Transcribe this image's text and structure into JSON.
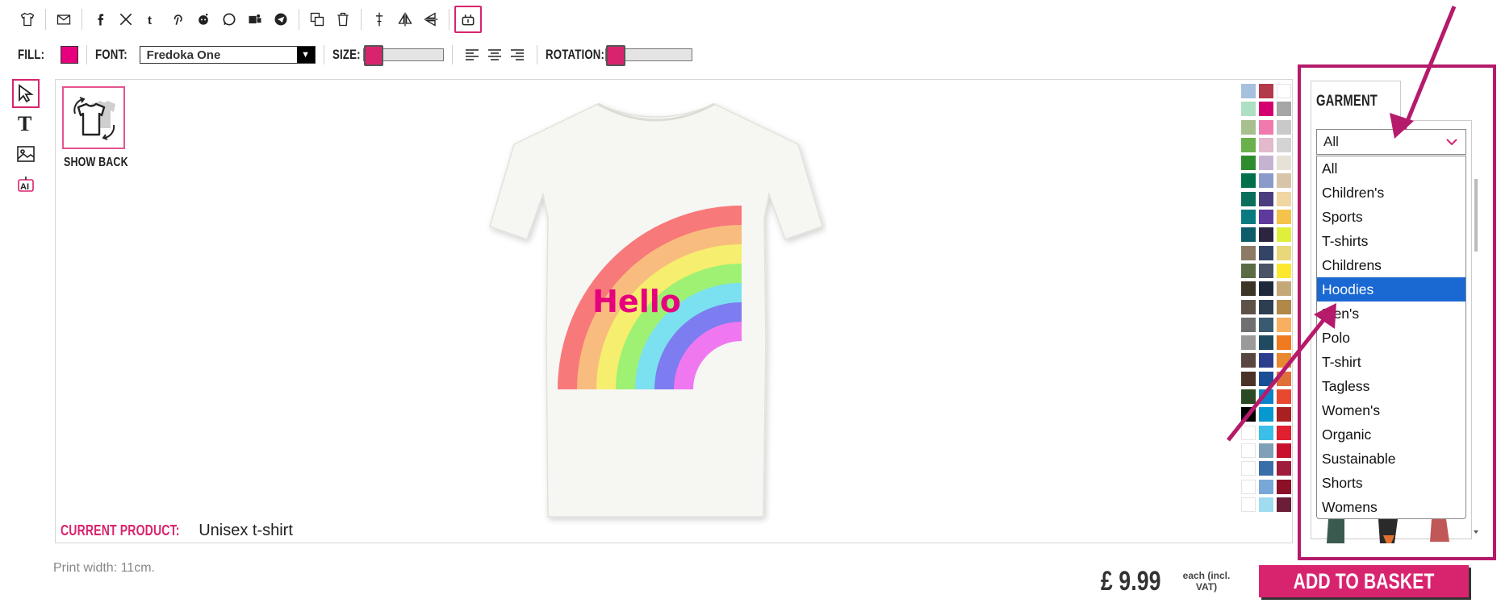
{
  "toolbar": {
    "icons": [
      "tshirt-icon",
      "email-icon",
      "facebook-icon",
      "x-icon",
      "tumblr-icon",
      "pinterest-icon",
      "reddit-icon",
      "whatsapp-icon",
      "teams-icon",
      "telegram-icon",
      "duplicate-icon",
      "delete-icon",
      "center-icon",
      "flip-horizontal-icon",
      "flip-vertical-icon",
      "snap-icon"
    ]
  },
  "props": {
    "fill_label": "FILL:",
    "fill_color": "#e6007e",
    "font_label": "FONT:",
    "font_value": "Fredoka One",
    "size_label": "SIZE:",
    "rotation_label": "ROTATION:",
    "size_level": 0.0,
    "rotation_level": 0.0
  },
  "canvas": {
    "show_back_label": "SHOW BACK",
    "design_text": "Hello",
    "current_product_label": "CURRENT PRODUCT:",
    "current_product_value": "Unisex t-shirt"
  },
  "palette": [
    "#a6c0dd",
    "#b33a4a",
    "#ffffff",
    "#aedfc2",
    "#d4006f",
    "#a6a6a6",
    "#a8c08e",
    "#f07aad",
    "#c9c9c9",
    "#6ab04c",
    "#e3b9cc",
    "#d4d4d4",
    "#2e8b2e",
    "#c6b3d2",
    "#e6e2d8",
    "#00704a",
    "#8a9acb",
    "#d8c4a8",
    "#0a6e5c",
    "#4b3e7f",
    "#f0d6a0",
    "#0a7a80",
    "#5d3a9b",
    "#f5c24a",
    "#0e5c6a",
    "#2b2540",
    "#e0f03a",
    "#8c7a64",
    "#334466",
    "#e8d87a",
    "#5a6b46",
    "#4a5466",
    "#fde830",
    "#3d3428",
    "#1e2a3a",
    "#c4a878",
    "#5e5248",
    "#2c3e50",
    "#b08848",
    "#707070",
    "#3a5a70",
    "#f8b060",
    "#9a9a9a",
    "#1f4a60",
    "#f07a20",
    "#5a4640",
    "#2c3e8c",
    "#e88830",
    "#4a3228",
    "#1a4e96",
    "#e0703a",
    "#2a4a24",
    "#0a82c8",
    "#e84830",
    "#000000",
    "#0898d0",
    "#a82020",
    "#ffffff",
    "#3ac0e8",
    "#e02030",
    "#ffffff",
    "#7fa0b6",
    "#c8102e",
    "#ffffff",
    "#3a6ea8",
    "#a01c3c",
    "#ffffff",
    "#78a8d8",
    "#8c1028",
    "#ffffff",
    "#a0dcf0",
    "#6a1e38"
  ],
  "garment": {
    "tab_label": "GARMENT",
    "selected": "All",
    "options": [
      "All",
      "Children's",
      "Sports",
      "T-shirts",
      "Childrens",
      "Hoodies",
      "Men's",
      "Polo",
      "T-shirt",
      "Tagless",
      "Women's",
      "Organic",
      "Sustainable",
      "Shorts",
      "Womens"
    ],
    "highlighted_option": "Hoodies"
  },
  "footer": {
    "print_width": "Print width: 11cm.",
    "price": "£ 9.99",
    "vat_note": "each (incl. VAT)",
    "add_to_basket": "ADD TO BASKET"
  },
  "colors": {
    "accent": "#d8246f",
    "panel_border": "#b51a6b",
    "highlight": "#1a68d2"
  }
}
